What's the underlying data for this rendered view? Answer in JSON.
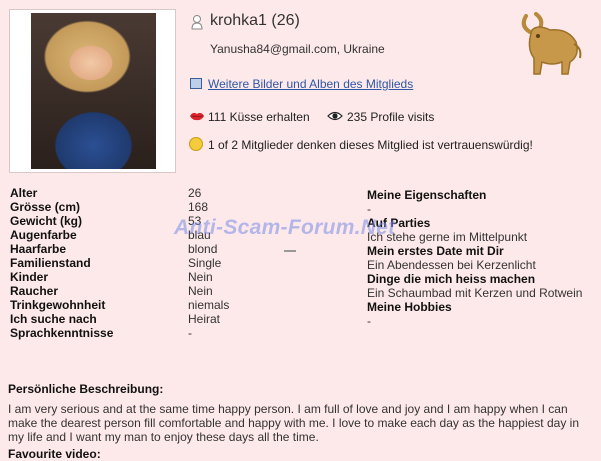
{
  "profile": {
    "username": "krohka1 (26)",
    "email_location": "Yanusha84@gmail.com, Ukraine",
    "gallery_link": "Weitere Bilder und Alben des Mitglieds",
    "kisses": "111 Küsse erhalten",
    "visits": "235 Profile visits",
    "trust": "1 of 2 Mitglieder denken dieses Mitglied ist vertrauenswürdig!"
  },
  "details": [
    {
      "label": "Alter",
      "value": "26"
    },
    {
      "label": "Grösse (cm)",
      "value": "168"
    },
    {
      "label": "Gewicht (kg)",
      "value": "53"
    },
    {
      "label": "Augenfarbe",
      "value": "blau"
    },
    {
      "label": "Haarfarbe",
      "value": "blond"
    },
    {
      "label": "Familienstand",
      "value": "Single"
    },
    {
      "label": "Kinder",
      "value": "Nein"
    },
    {
      "label": "Raucher",
      "value": "Nein"
    },
    {
      "label": "Trinkgewohnheit",
      "value": "niemals"
    },
    {
      "label": "Ich suche nach",
      "value": "Heirat"
    },
    {
      "label": "Sprachkenntnisse",
      "value": "-"
    }
  ],
  "right": {
    "h1": "Meine Eigenschaften",
    "t1": "-",
    "h2": "Auf Parties",
    "t2": "Ich stehe gerne im Mittelpunkt",
    "h3": "Mein erstes Date mit Dir",
    "t3": "Ein Abendessen bei Kerzenlicht",
    "h4": "Dinge die mich heiss machen",
    "t4": "Ein Schaumbad mit Kerzen und Rotwein",
    "h5": "Meine Hobbies",
    "t5": "-"
  },
  "watermark": "Anti-Scam-Forum.Net",
  "description": {
    "title": "Persönliche Beschreibung:",
    "body": "I am very serious and at the same time happy person. I am full of love and joy and I am happy when I can make the dearest person fill comfortable and happy with me. I love to make each day as the happiest day in my life and I want my man to enjoy these days all the time."
  },
  "video_title": "Favourite video:",
  "icons": {
    "user": "user-icon",
    "zodiac": "taurus-zodiac-icon",
    "gallery": "gallery-icon",
    "kiss": "lips-icon",
    "views": "eye-icon",
    "trust": "smiley-icon"
  },
  "colors": {
    "background": "#fde9ea",
    "link": "#2e56a6",
    "watermark": "#788ce6",
    "zodiac": "#b8893a"
  }
}
